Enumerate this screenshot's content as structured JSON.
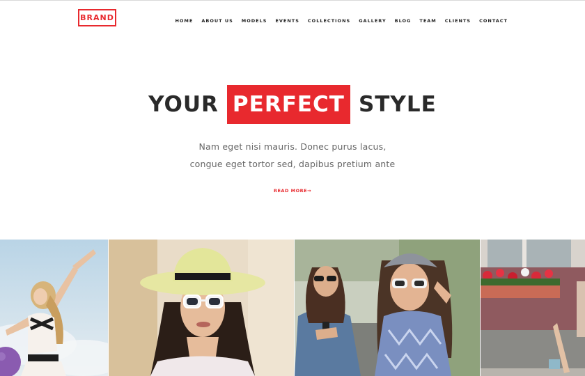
{
  "header": {
    "brand": "BRAND",
    "nav": [
      "HOME",
      "ABOUT US",
      "MODELS",
      "EVENTS",
      "COLLECTIONS",
      "GALLERY",
      "BLOG",
      "TEAM",
      "CLIENTS",
      "CONTACT"
    ]
  },
  "hero": {
    "title_before": "YOUR",
    "title_highlight": "PERFECT",
    "title_after": "STYLE",
    "subtitle_line1": "Nam eget nisi mauris. Donec purus lacus,",
    "subtitle_line2": "congue eget tortor sed, dapibus pretium ante",
    "read_more": "READ MORE→"
  },
  "colors": {
    "accent": "#e8292e",
    "text_dark": "#2a2a2a",
    "text_muted": "#666666"
  },
  "gallery": {
    "photos": [
      "jumping-woman-photo",
      "hat-sunglasses-woman-photo",
      "two-friends-phone-photo",
      "window-flowers-woman-photo"
    ]
  }
}
